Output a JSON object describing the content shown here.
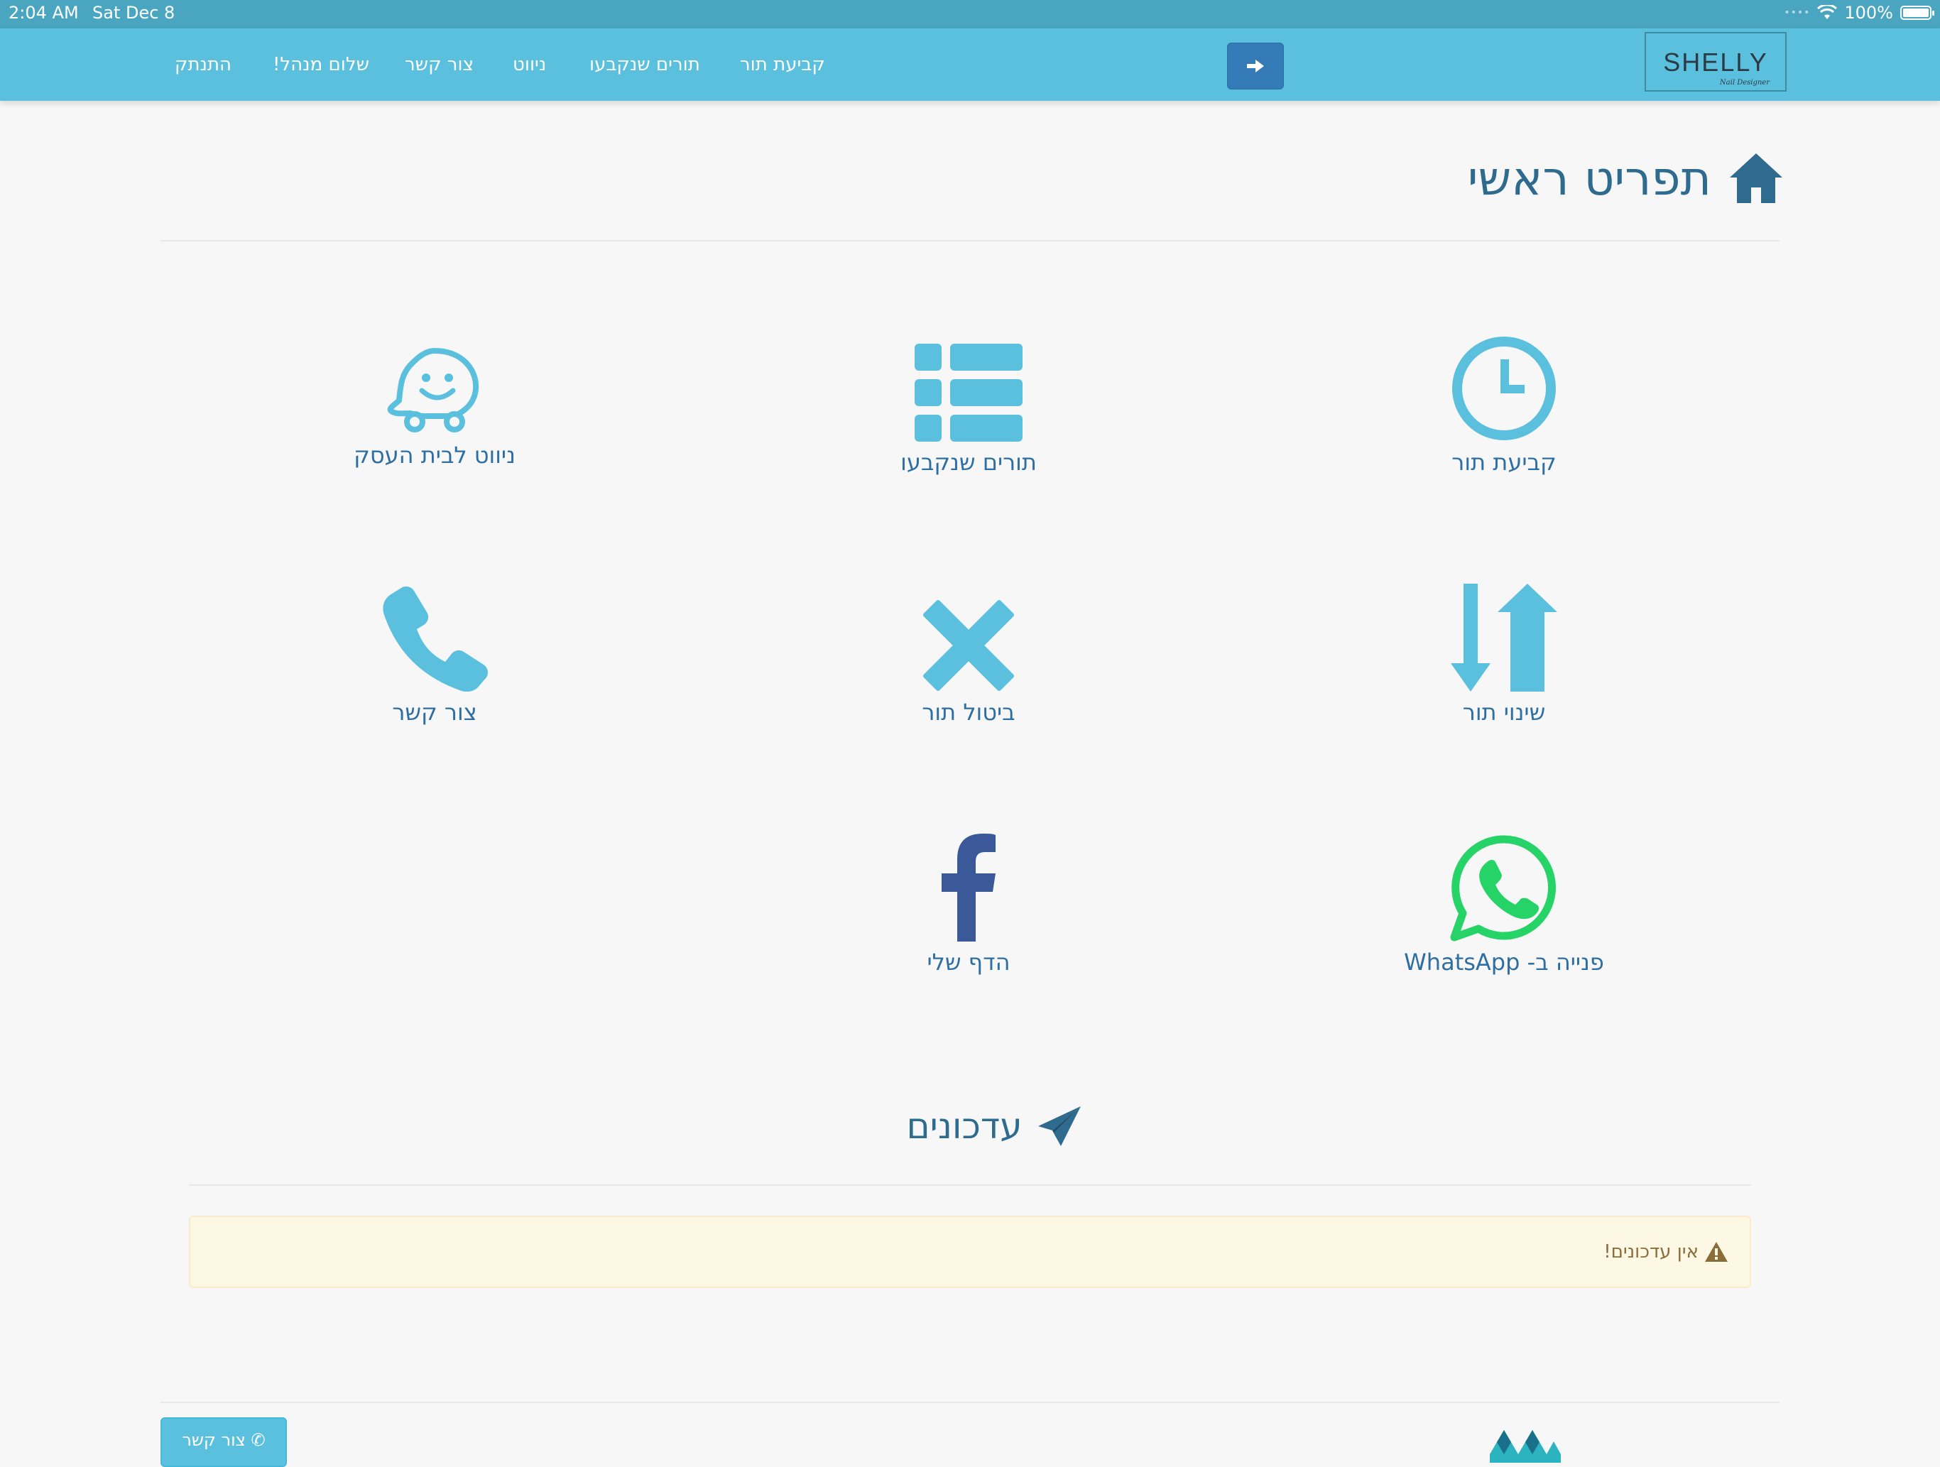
{
  "status_bar": {
    "time": "2:04 AM",
    "date": "Sat Dec 8",
    "battery": "100%"
  },
  "navbar": {
    "brand": {
      "name": "SHELLY",
      "sub": "Nail Designer"
    },
    "links": [
      {
        "label": "קביעת תור"
      },
      {
        "label": "תורים שנקבעו"
      },
      {
        "label": "ניווט"
      },
      {
        "label": "צור קשר"
      },
      {
        "label": "שלום מנהל!"
      },
      {
        "label": "התנתק"
      }
    ],
    "action_icon": "arrow-right-icon"
  },
  "page": {
    "title": "תפריט ראשי",
    "title_icon": "home-icon"
  },
  "tiles": [
    {
      "label": "קביעת תור",
      "icon": "clock-icon"
    },
    {
      "label": "תורים שנקבעו",
      "icon": "list-icon"
    },
    {
      "label": "ניווט לבית העסק",
      "icon": "waze-icon"
    },
    {
      "label": "שינוי תור",
      "icon": "sort-arrows-icon"
    },
    {
      "label": "ביטול תור",
      "icon": "x-icon"
    },
    {
      "label": "צור קשר",
      "icon": "phone-icon"
    },
    {
      "label": "פנייה ב- WhatsApp",
      "icon": "whatsapp-icon"
    },
    {
      "label": "הדף שלי",
      "icon": "facebook-icon"
    }
  ],
  "updates": {
    "title": "עדכונים",
    "title_icon": "paper-plane-icon",
    "empty_message": "אין עדכונים!",
    "alert_icon": "warning-icon"
  },
  "footer": {
    "contact_button": "צור קשר"
  },
  "colors": {
    "navbar": "#5bc0de",
    "primary_button": "#337ab7",
    "icon_blue": "#5bc0de",
    "title_blue": "#2e6b8f",
    "whatsapp_green": "#25d366",
    "facebook_blue": "#3b5998",
    "alert_bg": "#fcf8e3",
    "alert_text": "#8a6d3b"
  }
}
